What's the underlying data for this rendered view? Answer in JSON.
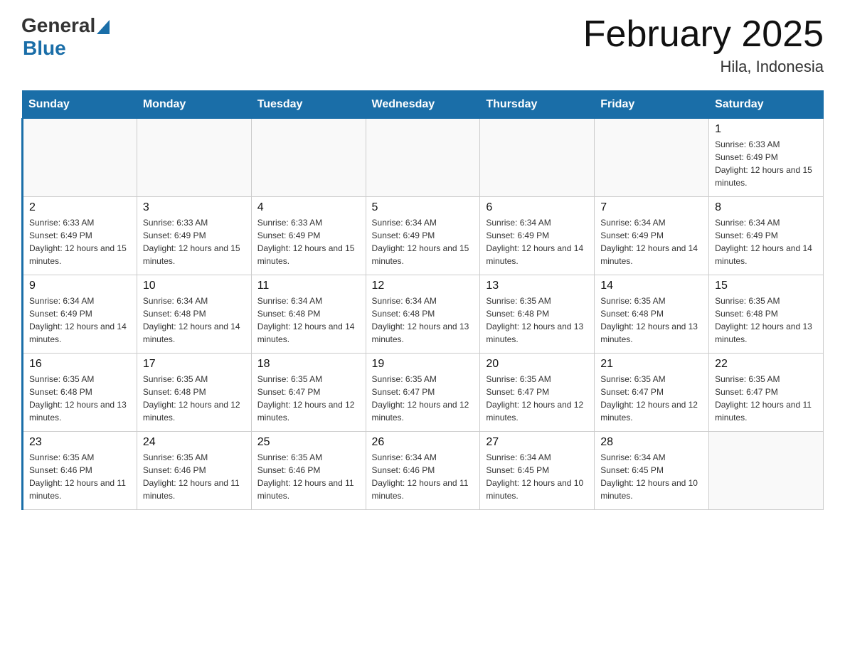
{
  "header": {
    "logo_general": "General",
    "logo_blue": "Blue",
    "title": "February 2025",
    "subtitle": "Hila, Indonesia"
  },
  "days_of_week": [
    "Sunday",
    "Monday",
    "Tuesday",
    "Wednesday",
    "Thursday",
    "Friday",
    "Saturday"
  ],
  "weeks": [
    [
      {
        "day": "",
        "info": ""
      },
      {
        "day": "",
        "info": ""
      },
      {
        "day": "",
        "info": ""
      },
      {
        "day": "",
        "info": ""
      },
      {
        "day": "",
        "info": ""
      },
      {
        "day": "",
        "info": ""
      },
      {
        "day": "1",
        "info": "Sunrise: 6:33 AM\nSunset: 6:49 PM\nDaylight: 12 hours and 15 minutes."
      }
    ],
    [
      {
        "day": "2",
        "info": "Sunrise: 6:33 AM\nSunset: 6:49 PM\nDaylight: 12 hours and 15 minutes."
      },
      {
        "day": "3",
        "info": "Sunrise: 6:33 AM\nSunset: 6:49 PM\nDaylight: 12 hours and 15 minutes."
      },
      {
        "day": "4",
        "info": "Sunrise: 6:33 AM\nSunset: 6:49 PM\nDaylight: 12 hours and 15 minutes."
      },
      {
        "day": "5",
        "info": "Sunrise: 6:34 AM\nSunset: 6:49 PM\nDaylight: 12 hours and 15 minutes."
      },
      {
        "day": "6",
        "info": "Sunrise: 6:34 AM\nSunset: 6:49 PM\nDaylight: 12 hours and 14 minutes."
      },
      {
        "day": "7",
        "info": "Sunrise: 6:34 AM\nSunset: 6:49 PM\nDaylight: 12 hours and 14 minutes."
      },
      {
        "day": "8",
        "info": "Sunrise: 6:34 AM\nSunset: 6:49 PM\nDaylight: 12 hours and 14 minutes."
      }
    ],
    [
      {
        "day": "9",
        "info": "Sunrise: 6:34 AM\nSunset: 6:49 PM\nDaylight: 12 hours and 14 minutes."
      },
      {
        "day": "10",
        "info": "Sunrise: 6:34 AM\nSunset: 6:48 PM\nDaylight: 12 hours and 14 minutes."
      },
      {
        "day": "11",
        "info": "Sunrise: 6:34 AM\nSunset: 6:48 PM\nDaylight: 12 hours and 14 minutes."
      },
      {
        "day": "12",
        "info": "Sunrise: 6:34 AM\nSunset: 6:48 PM\nDaylight: 12 hours and 13 minutes."
      },
      {
        "day": "13",
        "info": "Sunrise: 6:35 AM\nSunset: 6:48 PM\nDaylight: 12 hours and 13 minutes."
      },
      {
        "day": "14",
        "info": "Sunrise: 6:35 AM\nSunset: 6:48 PM\nDaylight: 12 hours and 13 minutes."
      },
      {
        "day": "15",
        "info": "Sunrise: 6:35 AM\nSunset: 6:48 PM\nDaylight: 12 hours and 13 minutes."
      }
    ],
    [
      {
        "day": "16",
        "info": "Sunrise: 6:35 AM\nSunset: 6:48 PM\nDaylight: 12 hours and 13 minutes."
      },
      {
        "day": "17",
        "info": "Sunrise: 6:35 AM\nSunset: 6:48 PM\nDaylight: 12 hours and 12 minutes."
      },
      {
        "day": "18",
        "info": "Sunrise: 6:35 AM\nSunset: 6:47 PM\nDaylight: 12 hours and 12 minutes."
      },
      {
        "day": "19",
        "info": "Sunrise: 6:35 AM\nSunset: 6:47 PM\nDaylight: 12 hours and 12 minutes."
      },
      {
        "day": "20",
        "info": "Sunrise: 6:35 AM\nSunset: 6:47 PM\nDaylight: 12 hours and 12 minutes."
      },
      {
        "day": "21",
        "info": "Sunrise: 6:35 AM\nSunset: 6:47 PM\nDaylight: 12 hours and 12 minutes."
      },
      {
        "day": "22",
        "info": "Sunrise: 6:35 AM\nSunset: 6:47 PM\nDaylight: 12 hours and 11 minutes."
      }
    ],
    [
      {
        "day": "23",
        "info": "Sunrise: 6:35 AM\nSunset: 6:46 PM\nDaylight: 12 hours and 11 minutes."
      },
      {
        "day": "24",
        "info": "Sunrise: 6:35 AM\nSunset: 6:46 PM\nDaylight: 12 hours and 11 minutes."
      },
      {
        "day": "25",
        "info": "Sunrise: 6:35 AM\nSunset: 6:46 PM\nDaylight: 12 hours and 11 minutes."
      },
      {
        "day": "26",
        "info": "Sunrise: 6:34 AM\nSunset: 6:46 PM\nDaylight: 12 hours and 11 minutes."
      },
      {
        "day": "27",
        "info": "Sunrise: 6:34 AM\nSunset: 6:45 PM\nDaylight: 12 hours and 10 minutes."
      },
      {
        "day": "28",
        "info": "Sunrise: 6:34 AM\nSunset: 6:45 PM\nDaylight: 12 hours and 10 minutes."
      },
      {
        "day": "",
        "info": ""
      }
    ]
  ]
}
